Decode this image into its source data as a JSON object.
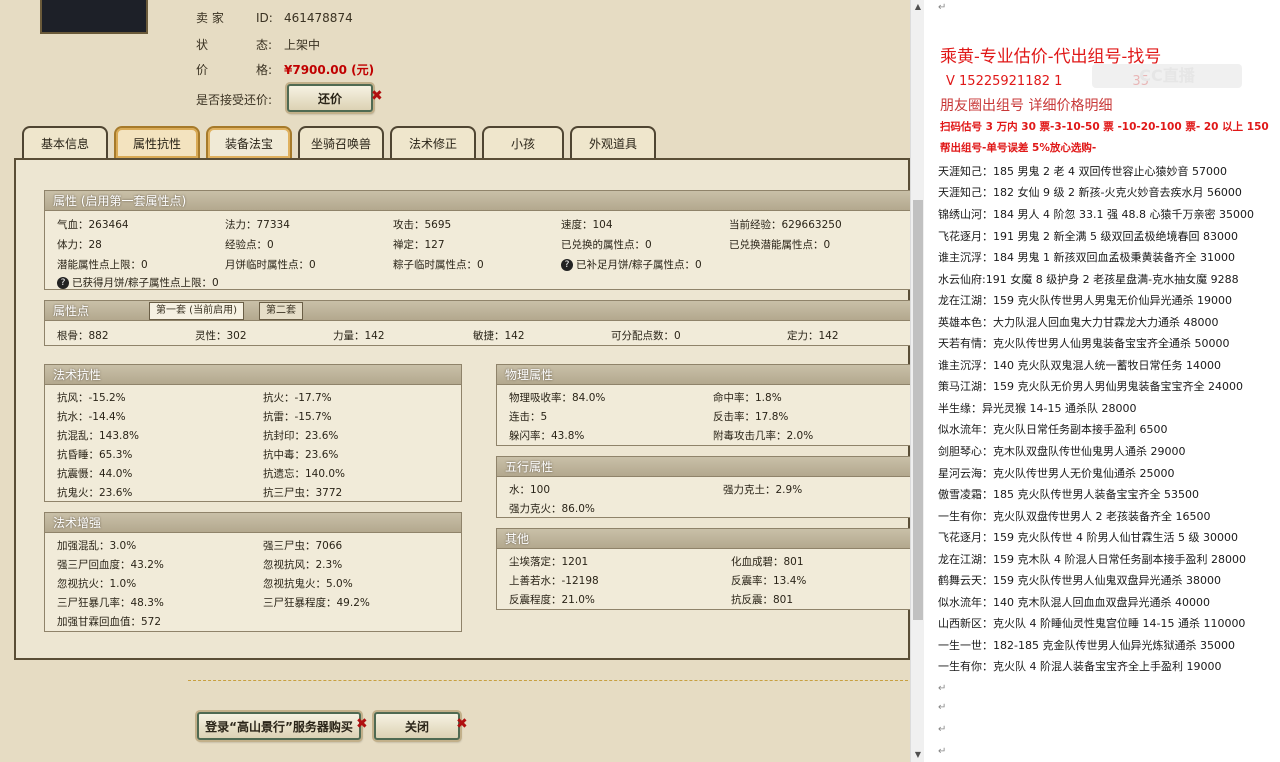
{
  "seller": {
    "id_key": "卖 家",
    "id_label": "ID:",
    "id_value": "461478874",
    "status_key": "状",
    "status_key2": "态:",
    "status_value": "上架中",
    "price_key": "价",
    "price_key2": "格:",
    "price_value": "¥7900.00 (元)",
    "counter_label": "是否接受还价:",
    "counter_button": "还价"
  },
  "tabs": [
    "基本信息",
    "属性抗性",
    "装备法宝",
    "坐骑召唤兽",
    "法术修正",
    "小孩",
    "外观道具"
  ],
  "attr": {
    "title": "属性 (启用第一套属性点)",
    "cells": [
      "气血：263464",
      "法力：77334",
      "攻击：5695",
      "速度：104",
      "当前经验：629663250",
      "体力：28",
      "经验点：0",
      "禅定：127",
      "已兑换的属性点：0",
      "已兑换潜能属性点：0",
      "潜能属性点上限：0",
      "月饼临时属性点：0",
      "粽子临时属性点：0",
      "已补足月饼/粽子属性点：0",
      "已获得月饼/粽子属性点上限：0"
    ]
  },
  "points": {
    "title": "属性点",
    "subtab1": "第一套 (当前启用)",
    "subtab2": "第二套",
    "cells": [
      "根骨：882",
      "灵性：302",
      "力量：142",
      "敏捷：142",
      "可分配点数：0",
      "定力：142"
    ]
  },
  "resist": {
    "title": "法术抗性",
    "cells": [
      "抗风：-15.2%",
      "抗火：-17.7%",
      "抗水：-14.4%",
      "抗雷：-15.7%",
      "抗混乱：143.8%",
      "抗封印：23.6%",
      "抗昏睡：65.3%",
      "抗中毒：23.6%",
      "抗震慑：44.0%",
      "抗遗忘：140.0%",
      "抗鬼火：23.6%",
      "抗三尸虫：3772"
    ]
  },
  "boost": {
    "title": "法术增强",
    "cells": [
      "加强混乱：3.0%",
      "强三尸虫：7066",
      "强三尸回血度：43.2%",
      "忽视抗风：2.3%",
      "忽视抗火：1.0%",
      "忽视抗鬼火：5.0%",
      "三尸狂暴几率：48.3%",
      "三尸狂暴程度：49.2%",
      "加强甘霖回血值：572"
    ]
  },
  "physical": {
    "title": "物理属性",
    "cells": [
      "物理吸收率：84.0%",
      "命中率：1.8%",
      "连击：5",
      "反击率：17.8%",
      "躲闪率：43.8%",
      "附毒攻击几率：2.0%"
    ]
  },
  "five": {
    "title": "五行属性",
    "cells": [
      "水：100",
      "强力克土：2.9%",
      "强力克火：86.0%"
    ]
  },
  "other": {
    "title": "其他",
    "cells": [
      "尘埃落定：1201",
      "化血成碧：801",
      "上善若水：-12198",
      "反震率：13.4%",
      "反震程度：21.0%",
      "抗反震：801"
    ]
  },
  "footer": {
    "login_button": "登录“高山景行”服务器购买",
    "close_button": "关闭"
  },
  "doc": {
    "header1": "乘黄-专业估价-代出组号-找号",
    "header2": "V 15225921182   1",
    "header2b": "35",
    "header3": "朋友圈出组号     详细价格明细",
    "header4": "扫码估号 3 万内 30 票-3-10-50 票  -10-20-100 票- 20 以上 150",
    "header5": "帮出组号-单号误差 5%放心选购-",
    "lines": [
      "天涯知己：185 男鬼 2 老 4 双回传世容止心猿妙音 57000",
      "天涯知己：182 女仙 9 级 2 新孩-火克火妙音去疾水月 56000",
      "锦绣山河：184 男人 4 阶忽 33.1 强 48.8 心猿千万亲密 35000",
      "飞花逐月：191 男鬼 2 新全满 5 级双回孟极绝境春回 83000",
      "谁主沉浮：184 男鬼 1 新孩双回血孟极秉黄装备齐全 31000",
      "水云仙府:191 女魔 8 级护身 2 老孩星盘满-克水抽女魔 9288",
      "龙在江湖：159 克火队传世男人男鬼无价仙异光通杀 19000",
      "英雄本色：大力队混人回血鬼大力甘霖龙大力通杀 48000",
      "天若有情：克火队传世男人仙男鬼装备宝宝齐全通杀 50000",
      "谁主沉浮：140 克火队双鬼混人统一蓄牧日常任务 14000",
      "策马江湖：159 克火队无价男人男仙男鬼装备宝宝齐全 24000",
      "半生缘：异光灵猴 14-15 通杀队 28000",
      "似水流年：克火队日常任务副本接手盈利 6500",
      "剑胆琴心：克木队双盘队传世仙鬼男人通杀 29000",
      "星河云海：克火队传世男人无价鬼仙通杀 25000",
      "傲雪凌霜：185 克火队传世男人装备宝宝齐全 53500",
      "一生有你：克火队双盘传世男人 2 老孩装备齐全 16500",
      "飞花逐月：159 克火队传世 4 阶男人仙甘霖生活 5 级 30000",
      "龙在江湖：159 克木队 4 阶混人日常任务副本接手盈利 28000",
      "鹤舞云天：159 克火队传世男人仙鬼双盘异光通杀 38000",
      "似水流年：140 克木队混人回血血双盘异光通杀 40000",
      "山西新区：克火队 4 阶睡仙灵性鬼宫位睡 14-15 通杀 110000",
      "一生一世：182-185 克金队传世男人仙异光炼狱通杀 35000",
      "一生有你：克火队 4 阶混人装备宝宝齐全上手盈利 19000"
    ],
    "return_mark": "↵",
    "watermark": "CC直播"
  },
  "colors": {
    "panel_bg": "#e6dcc3",
    "price_red": "#c00000",
    "doc_red": "#e01818",
    "doc_red_light": "#c83838"
  }
}
